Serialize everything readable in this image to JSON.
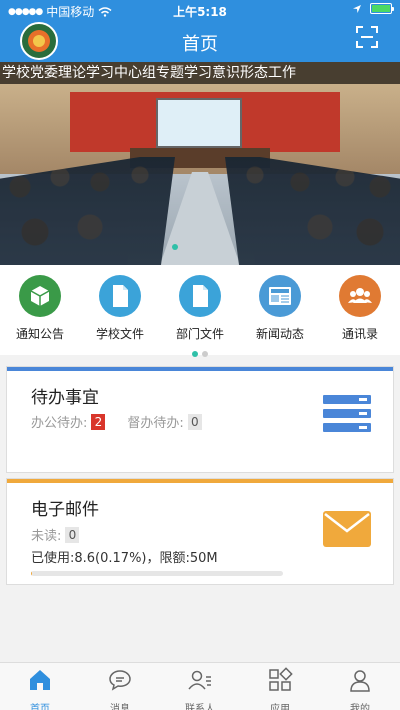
{
  "status_bar": {
    "carrier": "中国移动",
    "time": "上午5:18"
  },
  "header": {
    "title": "首页"
  },
  "banner": {
    "ticker_text": "学校党委理论学习中心组专题学习意识形态工作"
  },
  "quick_menu": [
    {
      "label": "通知公告",
      "color": "#3a9a48",
      "icon": "cube-icon"
    },
    {
      "label": "学校文件",
      "color": "#3ba3d9",
      "icon": "document-icon"
    },
    {
      "label": "部门文件",
      "color": "#3ba3d9",
      "icon": "document-icon"
    },
    {
      "label": "新闻动态",
      "color": "#4a9ad6",
      "icon": "news-icon"
    },
    {
      "label": "通讯录",
      "color": "#e07a33",
      "icon": "contacts-icon"
    }
  ],
  "todo_card": {
    "title": "待办事宜",
    "office_label": "办公待办:",
    "office_count": "2",
    "supervise_label": "督办待办:",
    "supervise_count": "0",
    "accent": "#4a86d8"
  },
  "mail_card": {
    "title": "电子邮件",
    "unread_label": "未读:",
    "unread_count": "0",
    "usage_text": "已使用:8.6(0.17%)，限额:50M",
    "usage_fraction": 0.0017,
    "accent": "#f0a93c"
  },
  "tabbar": [
    {
      "label": "首页",
      "active": true
    },
    {
      "label": "消息",
      "active": false
    },
    {
      "label": "联系人",
      "active": false
    },
    {
      "label": "应用",
      "active": false
    },
    {
      "label": "我的",
      "active": false
    }
  ]
}
